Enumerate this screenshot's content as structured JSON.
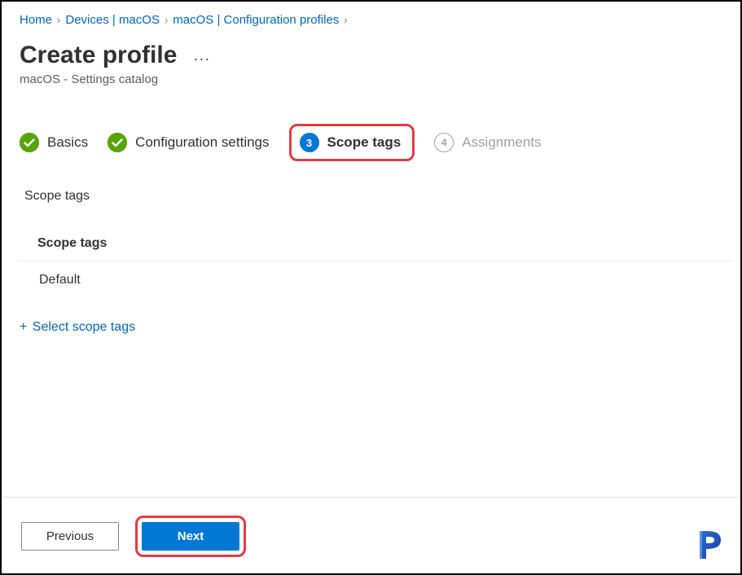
{
  "breadcrumb": {
    "home": "Home",
    "devices": "Devices | macOS",
    "profiles": "macOS | Configuration profiles"
  },
  "header": {
    "title": "Create profile",
    "subtitle": "macOS - Settings catalog"
  },
  "wizard": {
    "step1": "Basics",
    "step2": "Configuration settings",
    "step3_num": "3",
    "step3": "Scope tags",
    "step4_num": "4",
    "step4": "Assignments"
  },
  "section": {
    "title": "Scope tags",
    "table_header": "Scope tags",
    "row1": "Default",
    "add_link": "Select scope tags"
  },
  "footer": {
    "previous": "Previous",
    "next": "Next"
  }
}
